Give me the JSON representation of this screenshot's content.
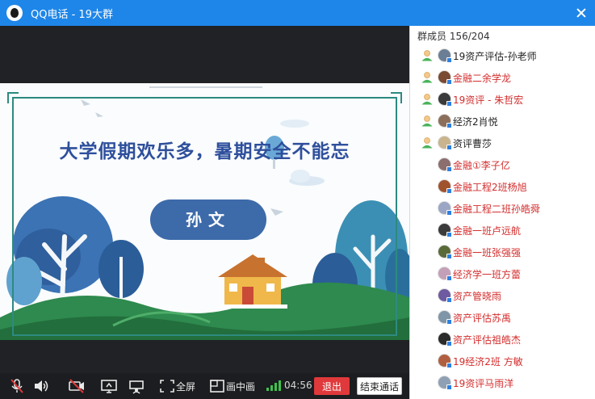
{
  "window": {
    "title": "QQ电话 - 19大群"
  },
  "slide": {
    "headline": "大学假期欢乐多，暑期安全不能忘",
    "presenter_name": "孙文",
    "colors": {
      "frame": "#2d8a80",
      "headline": "#2e4f9c",
      "pill": "#3d6aa9",
      "tree_blue": "#3b73b4",
      "grass": "#2e8a4e"
    }
  },
  "toolbar": {
    "mic_icon": "mic-muted-icon",
    "speaker_icon": "speaker-icon",
    "camera_icon": "camera-off-icon",
    "share_icon": "screen-share-icon",
    "presenter_icon": "presenter-icon",
    "fullscreen_label": "全屏",
    "pip_label": "画中画",
    "timer": "04:56",
    "exit_label": "退出",
    "end_call_label": "结束通话"
  },
  "members_panel": {
    "header": "群成员 156/204",
    "members": [
      {
        "name": "19资产评估-孙老师",
        "color": "dark",
        "person_icon": true,
        "avatar": "#6a7f95"
      },
      {
        "name": "金融二余学龙",
        "color": "red",
        "person_icon": true,
        "avatar": "#7a4a32"
      },
      {
        "name": "19资评 - 朱哲宏",
        "color": "red",
        "person_icon": true,
        "avatar": "#3a3a3a"
      },
      {
        "name": "经济2肖悦",
        "color": "dark",
        "person_icon": true,
        "avatar": "#8b6f5a"
      },
      {
        "name": "资评曹莎",
        "color": "dark",
        "person_icon": true,
        "avatar": "#c9b48e"
      },
      {
        "name": "金融①李子亿",
        "color": "red",
        "person_icon": false,
        "avatar": "#8c6e6e"
      },
      {
        "name": "金融工程2班杨旭",
        "color": "red",
        "person_icon": false,
        "avatar": "#a0522d"
      },
      {
        "name": "金融工程二班孙皓舜",
        "color": "red",
        "person_icon": false,
        "avatar": "#9aa6c4"
      },
      {
        "name": "金融一班卢远航",
        "color": "red",
        "person_icon": false,
        "avatar": "#3b3b3b"
      },
      {
        "name": "金融一班张强强",
        "color": "red",
        "person_icon": false,
        "avatar": "#5a6b3a"
      },
      {
        "name": "经济学一班方蕾",
        "color": "red",
        "person_icon": false,
        "avatar": "#c4a0b8"
      },
      {
        "name": "资产管晓雨",
        "color": "red",
        "person_icon": false,
        "avatar": "#6e5aa0"
      },
      {
        "name": "资产评估苏禹",
        "color": "red",
        "person_icon": false,
        "avatar": "#7f95a8"
      },
      {
        "name": "资产评估祖皓杰",
        "color": "red",
        "person_icon": false,
        "avatar": "#2b2b2b"
      },
      {
        "name": "19经济2班 方敏",
        "color": "red",
        "person_icon": false,
        "avatar": "#b06040"
      },
      {
        "name": "19资评马雨洋",
        "color": "red",
        "person_icon": false,
        "avatar": "#8fa0b4"
      }
    ]
  }
}
